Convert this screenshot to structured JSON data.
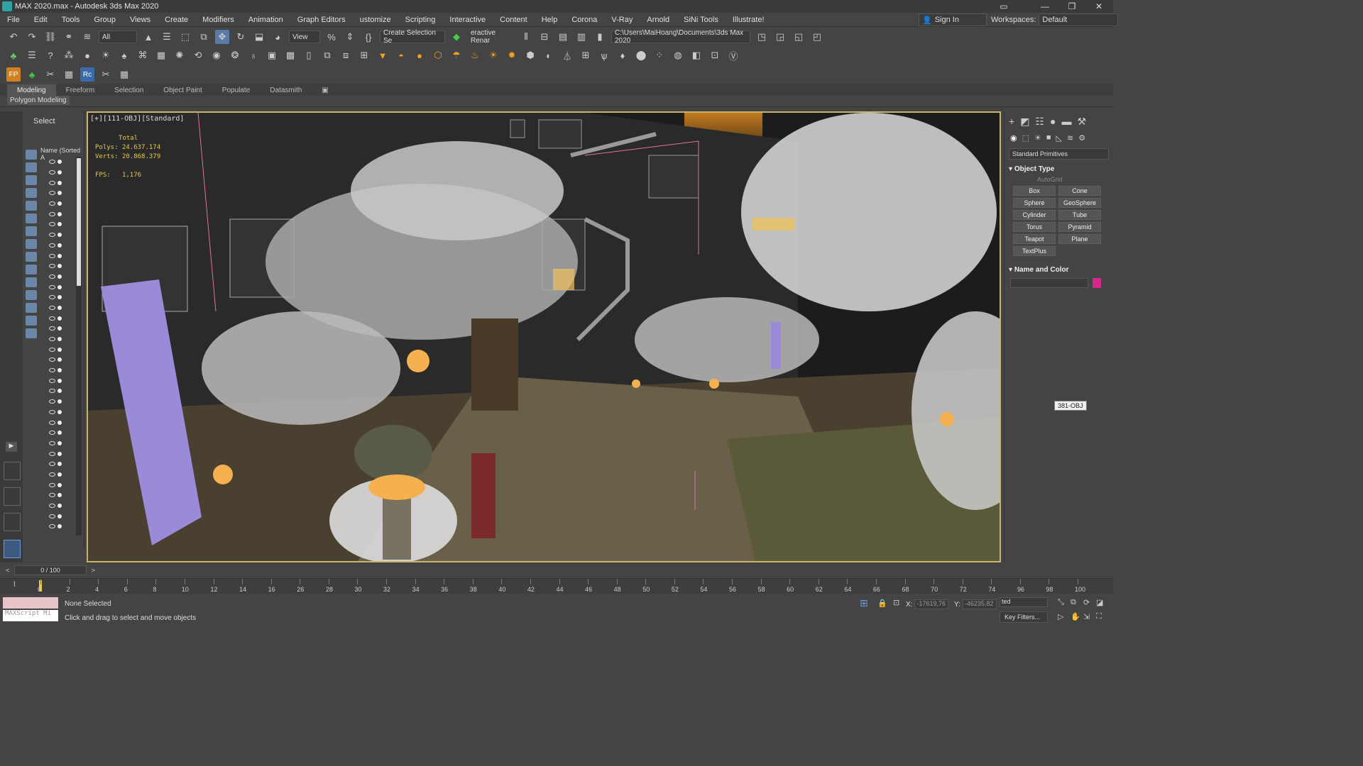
{
  "window": {
    "title": "MAX 2020.max - Autodesk 3ds Max 2020",
    "minimize": "—",
    "maximize": "❐",
    "close": "✕"
  },
  "menu": [
    "File",
    "Edit",
    "Tools",
    "Group",
    "Views",
    "Create",
    "Modifiers",
    "Animation",
    "Graph Editors",
    "ustomize",
    "Scripting",
    "Interactive",
    "Content",
    "Help",
    "Corona",
    "V-Ray",
    "Arnold",
    "SiNi Tools",
    "Illustrate!"
  ],
  "account": {
    "signin": "Sign In",
    "workspaces_label": "Workspaces:",
    "workspace": "Default"
  },
  "toolbar": {
    "selection_filter": "All",
    "ref_coord": "View",
    "named_selection": "Create Selection Se",
    "interactive_renamer": "eractive Renar",
    "project_path": "C:\\Users\\MaiHoang\\Documents\\3ds Max 2020"
  },
  "ribbon": {
    "tabs": [
      "Modeling",
      "Freeform",
      "Selection",
      "Object Paint",
      "Populate",
      "Datasmith"
    ],
    "active_tab": "Modeling",
    "sub": "Polygon Modeling"
  },
  "scene_explorer": {
    "tab": "Select",
    "column": "Name (Sorted A"
  },
  "viewport": {
    "label": "[+][111-OBJ][Standard]",
    "stats_total": "Total",
    "polys_label": "Polys:",
    "polys": "24.637.174",
    "verts_label": "Verts:",
    "verts": "20.868.379",
    "fps_label": "FPS:",
    "fps": "1,176",
    "tooltip": "381-OBJ"
  },
  "command_panel": {
    "category": "Standard Primitives",
    "object_type": "Object Type",
    "autogrid": "AutoGrid",
    "primitives": [
      "Box",
      "Cone",
      "Sphere",
      "GeoSphere",
      "Cylinder",
      "Tube",
      "Torus",
      "Pyramid",
      "Teapot",
      "Plane",
      "TextPlus"
    ],
    "name_color": "Name and Color",
    "object_color": "#d4288c"
  },
  "time": {
    "slider": "0 / 100",
    "ticks": [
      "0",
      "2",
      "4",
      "6",
      "8",
      "10",
      "12",
      "14",
      "16",
      "26",
      "28",
      "30",
      "32",
      "34",
      "36",
      "38",
      "40",
      "42",
      "44",
      "46",
      "48",
      "50",
      "52",
      "54",
      "56",
      "58",
      "60",
      "62",
      "64",
      "66",
      "68",
      "70",
      "72",
      "74",
      "96",
      "98",
      "100"
    ]
  },
  "status": {
    "maxscript": "MAXScript Mi",
    "selection": "None Selected",
    "prompt": "Click and drag to select and move objects",
    "x_label": "X:",
    "x": "-17619,76",
    "y_label": "Y:",
    "y": "-46235,82",
    "selected": "ted",
    "key_filters": "Key Filters..."
  }
}
